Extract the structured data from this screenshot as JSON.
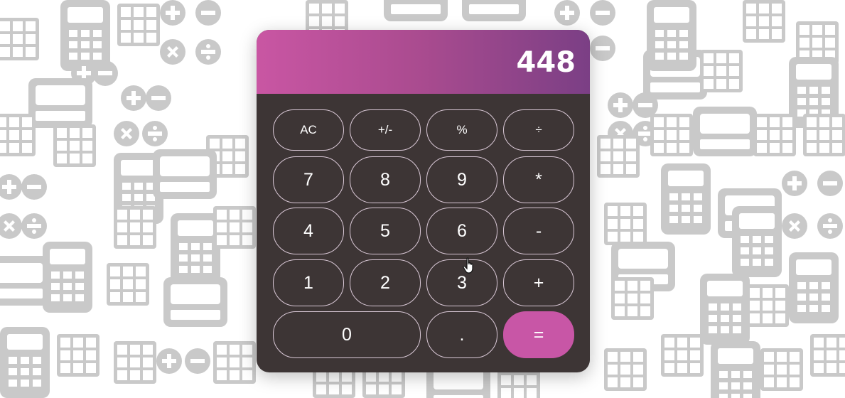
{
  "display": {
    "value": "448"
  },
  "keys": {
    "ac": "AC",
    "plus_minus": "+/-",
    "percent": "%",
    "divide": "÷",
    "seven": "7",
    "eight": "8",
    "nine": "9",
    "multiply": "*",
    "four": "4",
    "five": "5",
    "six": "6",
    "minus": "-",
    "one": "1",
    "two": "2",
    "three": "3",
    "plus": "+",
    "zero": "0",
    "decimal": ".",
    "equals": "="
  },
  "colors": {
    "display_gradient_start": "#c956a3",
    "display_gradient_end": "#7b3f85",
    "body": "#3d3535",
    "equals_button": "#c856a6",
    "button_border": "#d9c8d6",
    "background_pattern": "#c9c9c9"
  }
}
